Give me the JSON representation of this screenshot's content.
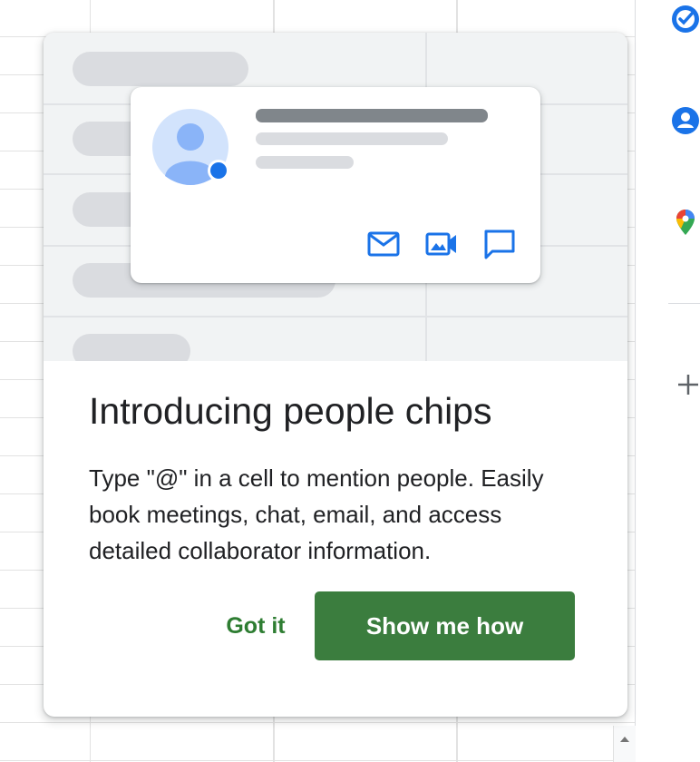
{
  "dialog": {
    "title": "Introducing people chips",
    "body": "Type \"@\" in a cell to mention people. Easily book meetings, chat, email, and access detailed collaborator information.",
    "secondary_button": "Got it",
    "primary_button": "Show me how"
  },
  "illustration": {
    "action_icons": [
      "mail-icon",
      "video-call-icon",
      "chat-icon"
    ]
  },
  "side_panel": {
    "icons": [
      "tasks-icon",
      "contacts-icon",
      "maps-icon",
      "add-icon"
    ]
  },
  "colors": {
    "primary_button": "#3b7d3e",
    "text_button": "#2e7d32",
    "accent_blue": "#1a73e8",
    "title_text": "#202124"
  }
}
